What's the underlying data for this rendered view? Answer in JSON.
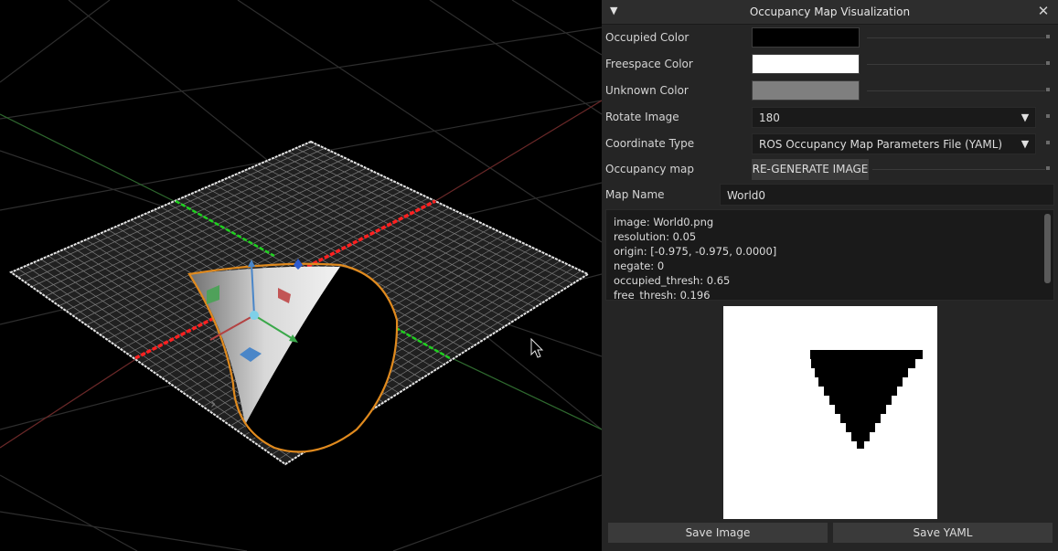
{
  "panel": {
    "title": "Occupancy Map Visualization",
    "collapse_icon": "triangle-down-icon",
    "close_icon": "close-icon",
    "occupied_color": {
      "label": "Occupied Color",
      "value": "#000000"
    },
    "freespace_color": {
      "label": "Freespace Color",
      "value": "#ffffff"
    },
    "unknown_color": {
      "label": "Unknown Color",
      "value": "#7f7f7f"
    },
    "rotate_image": {
      "label": "Rotate Image",
      "value": "180"
    },
    "coordinate_type": {
      "label": "Coordinate Type",
      "value": "ROS Occupancy Map Parameters File (YAML)"
    },
    "occupancy_map": {
      "label": "Occupancy map",
      "button": "RE-GENERATE IMAGE"
    },
    "map_name": {
      "label": "Map Name",
      "value": "World0"
    },
    "yaml_lines": [
      "image: World0.png",
      "resolution: 0.05",
      "origin: [-0.975, -0.975, 0.0000]",
      "negate: 0",
      "occupied_thresh: 0.65",
      "free_thresh: 0.196"
    ],
    "save_image_label": "Save Image",
    "save_yaml_label": "Save YAML"
  },
  "viewport": {
    "grid_color": "#2e2e2e",
    "plane_border_color": "#e6e6e6",
    "selection_color": "#e08a1e",
    "axis_x_color": "#ff2020",
    "axis_z_color": "#1fd11f",
    "expand_icon": "chevron-right-icon"
  }
}
